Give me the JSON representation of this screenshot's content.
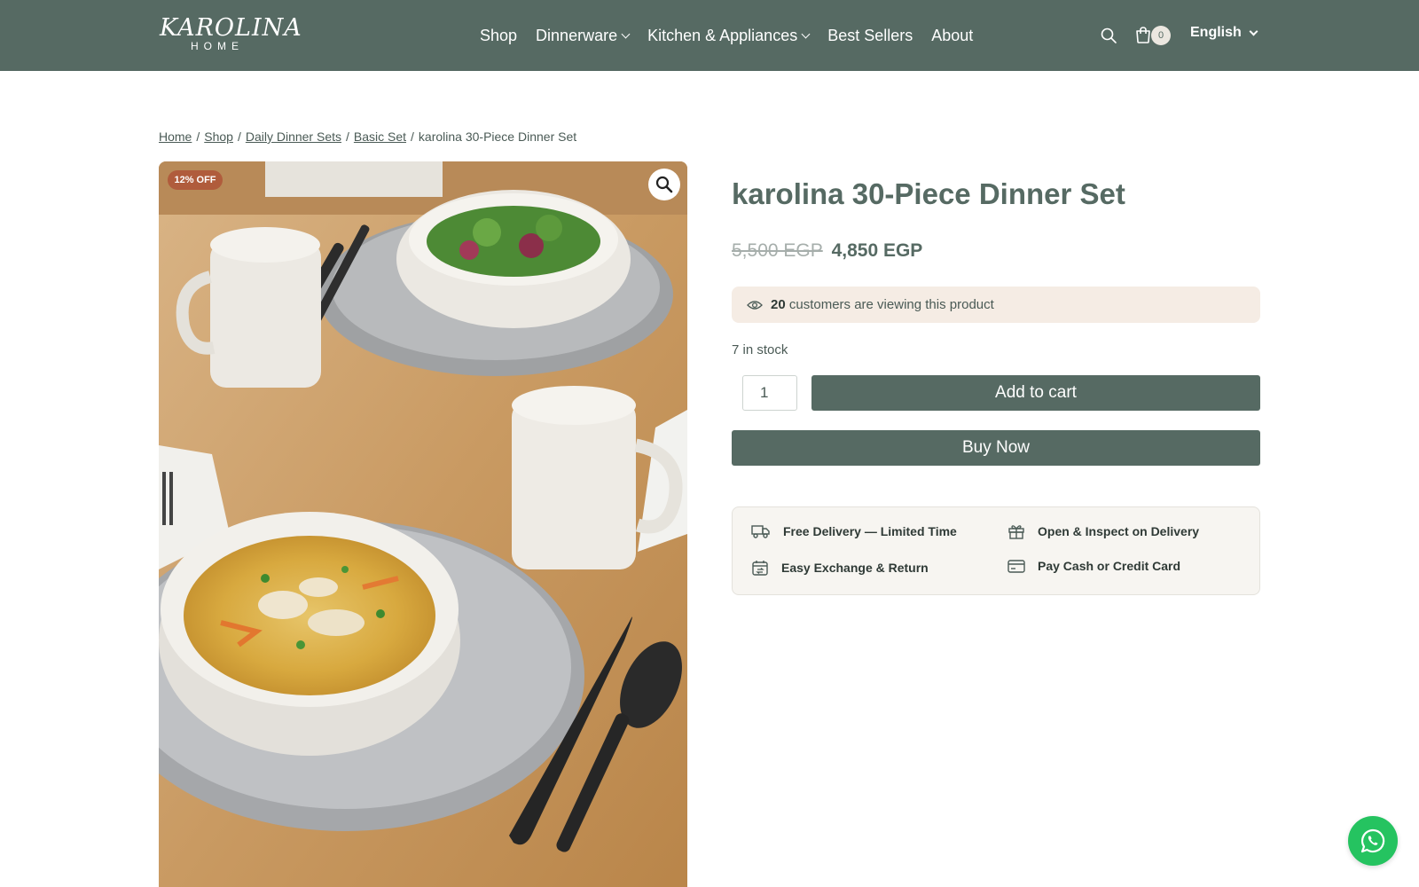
{
  "brand": {
    "logo_main": "KAROLINA",
    "logo_sub": "HOME"
  },
  "nav": {
    "items": [
      {
        "label": "Shop",
        "has_dropdown": false
      },
      {
        "label": "Dinnerware",
        "has_dropdown": true
      },
      {
        "label": "Kitchen & Appliances",
        "has_dropdown": true
      },
      {
        "label": "Best Sellers",
        "has_dropdown": false
      },
      {
        "label": "About",
        "has_dropdown": false
      }
    ]
  },
  "header": {
    "search_icon": "search-icon",
    "cart_icon": "cart-icon",
    "cart_count": "0",
    "language": "English"
  },
  "breadcrumb": {
    "links": [
      "Home",
      "Shop",
      "Daily Dinner Sets",
      "Basic Set"
    ],
    "separator": "/",
    "current": "karolina 30-Piece Dinner Set"
  },
  "product": {
    "badge": "12% OFF",
    "title": "karolina 30-Piece Dinner Set",
    "price_old": "5,500 EGP",
    "price_new": "4,850 EGP",
    "viewers_count": "20",
    "viewers_text": "customers are viewing this product",
    "stock": "7 in stock",
    "quantity": "1",
    "add_to_cart": "Add to cart",
    "buy_now": "Buy Now"
  },
  "features": [
    {
      "label": "Free Delivery — Limited Time",
      "icon": "truck-icon"
    },
    {
      "label": "Open & Inspect on Delivery",
      "icon": "gift-icon"
    },
    {
      "label": "Easy Exchange & Return",
      "icon": "exchange-calendar-icon"
    },
    {
      "label": "Pay Cash or Credit Card",
      "icon": "credit-card-icon"
    }
  ],
  "colors": {
    "header_bg": "#566a63",
    "button_bg": "#566a63",
    "badge_bg": "#b05c3c",
    "viewers_bg": "#f5ece4",
    "whatsapp": "#25c360"
  }
}
